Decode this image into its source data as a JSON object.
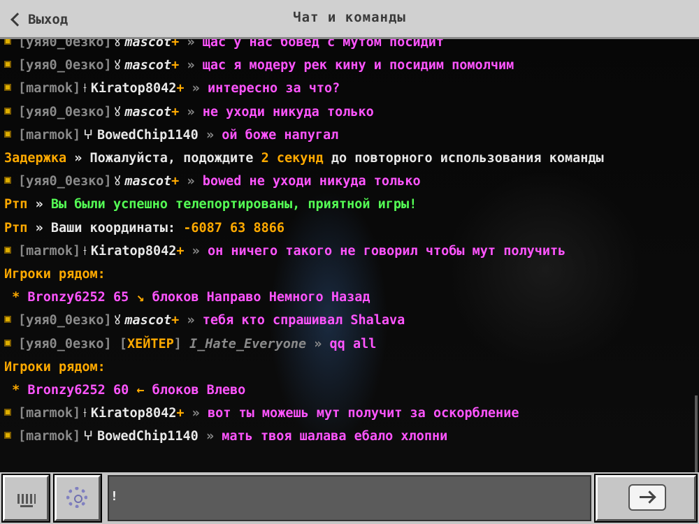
{
  "header": {
    "back_label": "Выход",
    "title": "Чат и команды"
  },
  "chat": {
    "cut_line": {
      "prefix": "[уяя0_0езко]",
      "sym": "ꙋ",
      "name": "mascot",
      "plus": "+",
      "arrow": "»",
      "msg": "щас у нас бовед с мутом посидит"
    },
    "l1": {
      "prefix": "[уяя0_0езко]",
      "sym": "ꙋ",
      "name": "mascot",
      "plus": "+",
      "arrow": "»",
      "msg": "щас я модеру рек кину и посидим помолчим"
    },
    "l2": {
      "prefix": "[marmok]",
      "sym": "⟊",
      "name": "Kiratop8042",
      "plus": "+",
      "arrow": "»",
      "msg": "интересно за что?"
    },
    "l3": {
      "prefix": "[уяя0_0езко]",
      "sym": "ꙋ",
      "name": "mascot",
      "plus": "+",
      "arrow": "»",
      "msg": "не уходи никуда только"
    },
    "l4": {
      "prefix": "[marmok]",
      "sym": "ⵖ",
      "name": "BowedChip1140",
      "arrow": "»",
      "msg": "ой боже напугал"
    },
    "l5": {
      "label": "Задержка",
      "arrow": "»",
      "text1": "Пожалуйста, подождите",
      "num": "2 секунд",
      "text2": "до повторного использования команды"
    },
    "l6": {
      "prefix": "[уяя0_0езко]",
      "sym": "ꙋ",
      "name": "mascot",
      "plus": "+",
      "arrow": "»",
      "msg": "bowed не уходи никуда только"
    },
    "l7": {
      "label": "Ртп",
      "arrow": "»",
      "text": "Вы были успешно телепортированы, приятной игры!"
    },
    "l8": {
      "label": "Ртп",
      "arrow": "»",
      "text": "Ваши координаты:",
      "coords": "-6087 63 8866"
    },
    "l9": {
      "prefix": "[marmok]",
      "sym": "⟊",
      "name": "Kiratop8042",
      "plus": "+",
      "arrow": "»",
      "msg": "он ничего такого не говорил чтобы мут получить"
    },
    "l10": {
      "text": "Игроки рядом:"
    },
    "l11": {
      "star": "*",
      "player": "Bronzy6252 65",
      "dir": "↘",
      "text": "блоков Направо Немного Назад"
    },
    "l12": {
      "prefix": "[уяя0_0езко]",
      "sym": "ꙋ",
      "name": "mascot",
      "plus": "+",
      "arrow": "»",
      "msg": "тебя кто спрашивал Shalava"
    },
    "l13": {
      "prefix": "[уяя0_0езко]",
      "tag_open": "[",
      "tag": "ХЕЙТЕР",
      "tag_close": "]",
      "name": "I_Hate_Everyone",
      "arrow": "»",
      "msg": "qq all"
    },
    "l14": {
      "text": "Игроки рядом:"
    },
    "l15": {
      "star": "*",
      "player": "Bronzy6252 60",
      "dir": "←",
      "text": "блоков Влево"
    },
    "l16": {
      "prefix": "[marmok]",
      "sym": "⟊",
      "name": "Kiratop8042",
      "plus": "+",
      "arrow": "»",
      "msg": "вот ты можешь мут получит за оскорбление"
    },
    "l17": {
      "prefix": "[marmok]",
      "sym": "ⵖ",
      "name": "BowedChip1140",
      "arrow": "»",
      "msg": "мать твоя шалава ебало хлопни"
    }
  },
  "input": {
    "value": "!"
  },
  "icons": {
    "back": "chevron-left-icon",
    "keyboard": "keyboard-icon",
    "settings": "gear-icon",
    "send": "arrow-right-icon"
  }
}
